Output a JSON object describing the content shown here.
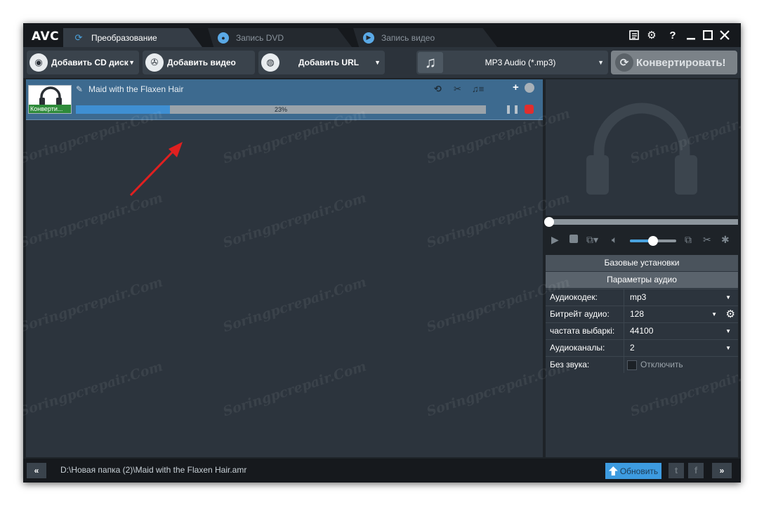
{
  "app": {
    "logo": "AVC",
    "tabs": [
      {
        "label": "Преобразование",
        "active": true,
        "icon": "refresh-icon"
      },
      {
        "label": "Запись DVD",
        "active": false,
        "icon": "disc-icon"
      },
      {
        "label": "Запись видео",
        "active": false,
        "icon": "play-circle-icon"
      }
    ],
    "window_buttons": {
      "help": "?"
    }
  },
  "toolbar": {
    "add_cd_label": "Добавить CD диск",
    "add_video_label": "Добавить видео",
    "add_url_label": "Добавить URL",
    "format_label": "MP3 Audio (*.mp3)",
    "convert_label": "Конвертировать!"
  },
  "file": {
    "name": "Maid with the Flaxen Hair",
    "status": "Конверти...",
    "progress_text": "23%",
    "progress": 0.23
  },
  "player": {
    "seek_position": 0.0,
    "volume": 0.5
  },
  "settings": {
    "basic_header": "Базовые установки",
    "audio_header": "Параметры аудио",
    "rows": [
      {
        "label": "Аудиокодек:",
        "value": "mp3"
      },
      {
        "label": "Битрейт аудио:",
        "value": "128"
      },
      {
        "label": "частата выбаркі:",
        "value": "44100"
      },
      {
        "label": "Аудиоканалы:",
        "value": "2"
      }
    ],
    "mute": {
      "label": "Без звука:",
      "value": "Отключить",
      "checked": false
    }
  },
  "status": {
    "collapse": "«",
    "expand": "»",
    "output_path": "D:\\Новая папка (2)\\Maid with the Flaxen Hair.amr",
    "update_label": "Обновить",
    "social": {
      "twitter": "t",
      "facebook": "f"
    }
  },
  "watermark": "Soringpcrepair.Com",
  "colors": {
    "accent": "#3f8fd2",
    "selected_row": "#3d6a8f",
    "stop_red": "#e02e2e",
    "status_green": "#2e8b3a",
    "annotation_arrow": "#e02020"
  }
}
